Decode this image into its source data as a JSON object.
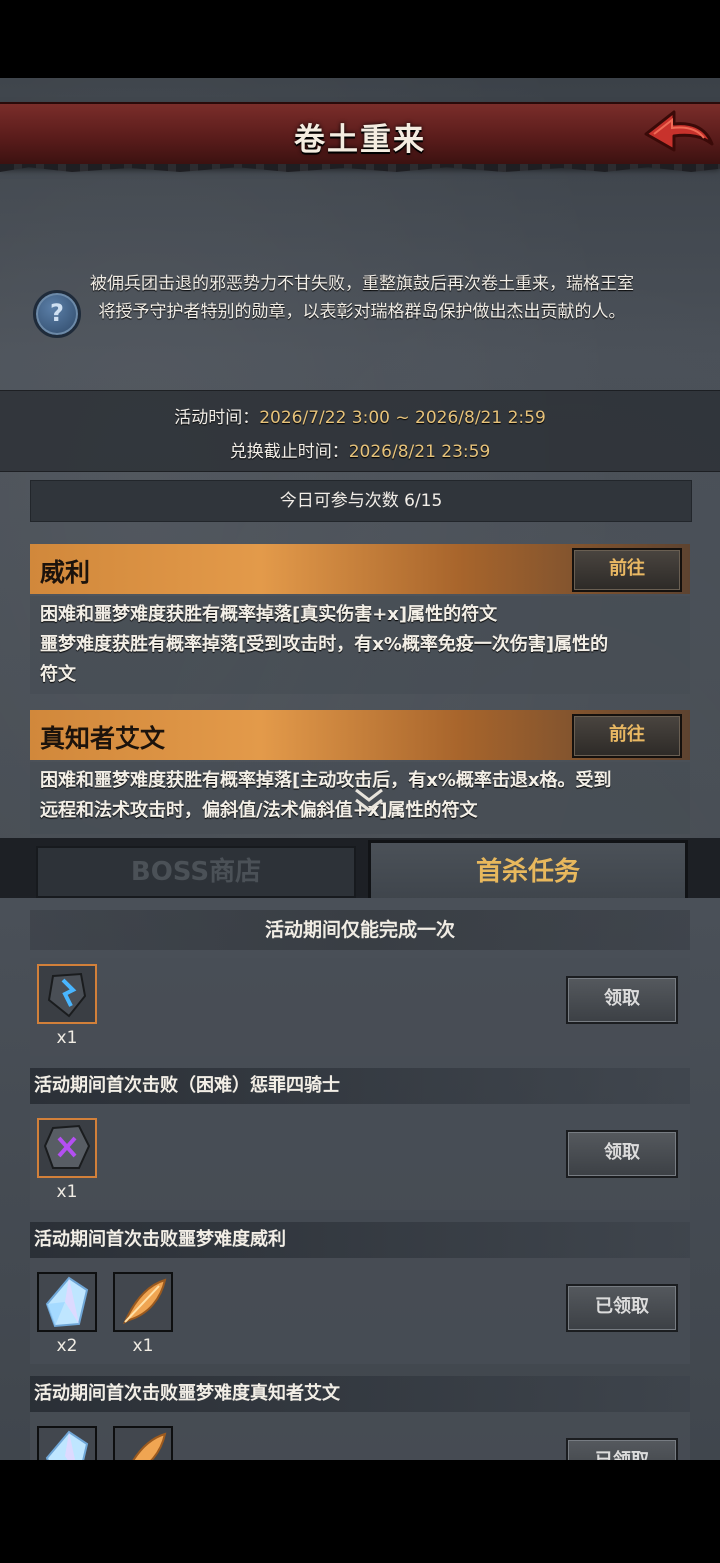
{
  "header": {
    "title": "卷土重来"
  },
  "description": "被佣兵团击退的邪恶势力不甘失败，重整旗鼓后再次卷土重来，瑞格王室将授予守护者特别的勋章，以表彰对瑞格群岛保护做出杰出贡献的人。",
  "time": {
    "activity_label": "活动时间：",
    "activity_value": "2026/7/22 3:00 ~ 2026/8/21 2:59",
    "exchange_label": "兑换截止时间：",
    "exchange_value": "2026/8/21 23:59"
  },
  "participation": "今日可参与次数  6/15",
  "bosses": [
    {
      "name": "威利",
      "go_label": "前往",
      "desc_line1": "困难和噩梦难度获胜有概率掉落[真实伤害+x]属性的符文",
      "desc_line2": "噩梦难度获胜有概率掉落[受到攻击时，有x%概率免疫一次伤害]属性的",
      "desc_line3": "符文"
    },
    {
      "name": "真知者艾文",
      "go_label": "前往",
      "desc_line1": "困难和噩梦难度获胜有概率掉落[主动攻击后，有x%概率击退x格。受到",
      "desc_line2": "远程和法术攻击时，偏斜值/法术偏斜值+x]属性的符文"
    }
  ],
  "tabs": {
    "boss_shop": "BOSS商店",
    "first_kill": "首杀任务"
  },
  "section_title": "活动期间仅能完成一次",
  "tasks": [
    {
      "title": "",
      "items": [
        {
          "icon": "blue-rune-icon",
          "qty": "x1"
        }
      ],
      "button": "领取"
    },
    {
      "title": "活动期间首次击败（困难）惩罪四骑士",
      "items": [
        {
          "icon": "purple-rune-icon",
          "qty": "x1"
        }
      ],
      "button": "领取"
    },
    {
      "title": "活动期间首次击败噩梦难度威利",
      "items": [
        {
          "icon": "crystal-icon",
          "qty": "x2"
        },
        {
          "icon": "feather-icon",
          "qty": "x1"
        }
      ],
      "button": "已领取"
    },
    {
      "title": "活动期间首次击败噩梦难度真知者艾文",
      "items": [
        {
          "icon": "crystal-icon",
          "qty": ""
        },
        {
          "icon": "feather-icon",
          "qty": ""
        }
      ],
      "button": "已领取"
    }
  ],
  "colors": {
    "accent_gold": "#e6c27a",
    "banner_red": "#7a2d2a",
    "boss_orange": "#e39a4a"
  }
}
